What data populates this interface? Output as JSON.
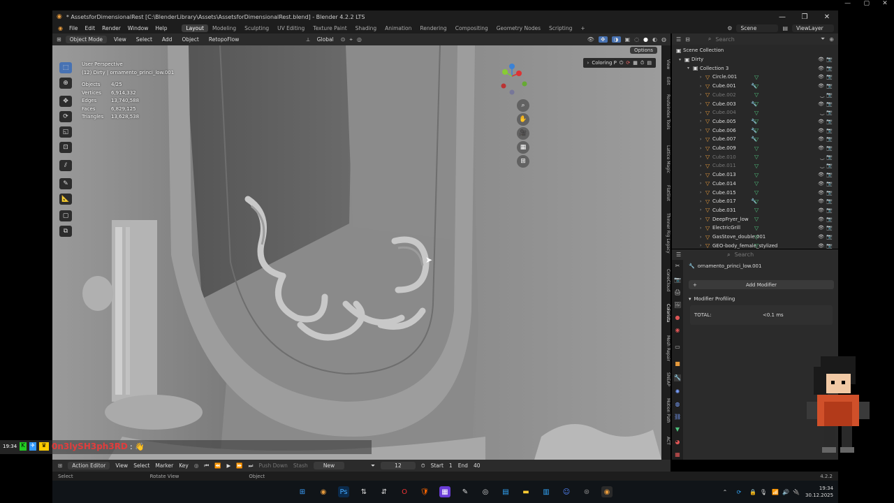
{
  "window": {
    "title": "* AssetsforDimensionalRest [C:\\BlenderLibrary\\Assets\\AssetsforDimensionalRest.blend] - Blender 4.2.2 LTS",
    "controls": [
      "—",
      "❐",
      "✕"
    ]
  },
  "outer_controls": [
    "—",
    "▢",
    "✕"
  ],
  "menubar": {
    "menus": [
      "File",
      "Edit",
      "Render",
      "Window",
      "Help"
    ],
    "workspaces": [
      "Layout",
      "Modeling",
      "Sculpting",
      "UV Editing",
      "Texture Paint",
      "Shading",
      "Animation",
      "Rendering",
      "Compositing",
      "Geometry Nodes",
      "Scripting"
    ],
    "active_workspace": "Layout",
    "add_tab": "+",
    "scene": "Scene",
    "view_layer": "ViewLayer"
  },
  "viewport_header": {
    "mode": "Object Mode",
    "menus": [
      "View",
      "Select",
      "Add",
      "Object"
    ],
    "addon": "RetopoFlow",
    "orientation": "Global",
    "options": "Options"
  },
  "viewport_overlay": {
    "view_name": "User Perspective",
    "object_line": "(12) Dirty | ornamento_princi_low.001",
    "stats": [
      {
        "label": "Objects",
        "value": "4/25"
      },
      {
        "label": "Vertices",
        "value": "6,914,332"
      },
      {
        "label": "Edges",
        "value": "13,740,588"
      },
      {
        "label": "Faces",
        "value": "6,829,125"
      },
      {
        "label": "Triangles",
        "value": "13,628,538"
      }
    ],
    "coloring_label": "Coloring P"
  },
  "n_panel_tabs": [
    "View",
    "Edit",
    "Routeindex Tools",
    "Lattice Magic",
    "FlatSlot",
    "Thinner Rig Legacy",
    "ConeCloud",
    "Colorista",
    "Mesh Repair",
    "SNEAP",
    "Motion Path",
    "ACT"
  ],
  "outliner": {
    "search_placeholder": "Search",
    "root": "Scene Collection",
    "collection": "Dirty",
    "sub_collection": "Collection 3",
    "items": [
      {
        "name": "Circle.001",
        "dim": false,
        "wrench": false
      },
      {
        "name": "Cube.001",
        "dim": false,
        "wrench": true
      },
      {
        "name": "Cube.002",
        "dim": true,
        "wrench": false
      },
      {
        "name": "Cube.003",
        "dim": false,
        "wrench": true
      },
      {
        "name": "Cube.004",
        "dim": true,
        "wrench": false
      },
      {
        "name": "Cube.005",
        "dim": false,
        "wrench": true
      },
      {
        "name": "Cube.006",
        "dim": false,
        "wrench": true
      },
      {
        "name": "Cube.007",
        "dim": false,
        "wrench": true
      },
      {
        "name": "Cube.009",
        "dim": false,
        "wrench": false
      },
      {
        "name": "Cube.010",
        "dim": true,
        "wrench": false
      },
      {
        "name": "Cube.011",
        "dim": true,
        "wrench": false
      },
      {
        "name": "Cube.013",
        "dim": false,
        "wrench": false
      },
      {
        "name": "Cube.014",
        "dim": false,
        "wrench": false
      },
      {
        "name": "Cube.015",
        "dim": false,
        "wrench": false
      },
      {
        "name": "Cube.017",
        "dim": false,
        "wrench": true
      },
      {
        "name": "Cube.031",
        "dim": false,
        "wrench": false
      },
      {
        "name": "DeepFryer_low",
        "dim": false,
        "wrench": false
      },
      {
        "name": "ElectricGrill",
        "dim": false,
        "wrench": false
      },
      {
        "name": "GasStove_double.001",
        "dim": false,
        "wrench": false
      },
      {
        "name": "GEO-body_female_stylized",
        "dim": false,
        "wrench": false
      }
    ]
  },
  "properties": {
    "search_placeholder": "Search",
    "object_name": "ornamento_princi_low.001",
    "add_modifier": "Add Modifier",
    "panel_title": "Modifier Profiling",
    "total_label": "TOTAL:",
    "total_value": "<0.1 ms"
  },
  "timeline": {
    "editor": "Action Editor",
    "menus": [
      "View",
      "Select",
      "Marker",
      "Key"
    ],
    "push_down": "Push Down",
    "stash": "Stash",
    "new": "New",
    "current_frame": "12",
    "start_label": "Start",
    "start_value": "1",
    "end_label": "End",
    "end_value": "40"
  },
  "statusbar": {
    "items": [
      "Select",
      "Rotate View",
      "Object"
    ],
    "version": "4.2.2"
  },
  "chat": {
    "time": "19:34",
    "username": "0n3lySH3ph3RD",
    "message": ": 👋"
  },
  "taskbar": {
    "time": "19:34",
    "date": "30.12.2025"
  },
  "colors": {
    "accent": "#4772b3",
    "viewport_bg": "#868686",
    "outliner_bg": "#282828",
    "modifier_green": "#4fc17d",
    "object_orange": "#e69a3c",
    "chat_name": "#e23d3d"
  }
}
